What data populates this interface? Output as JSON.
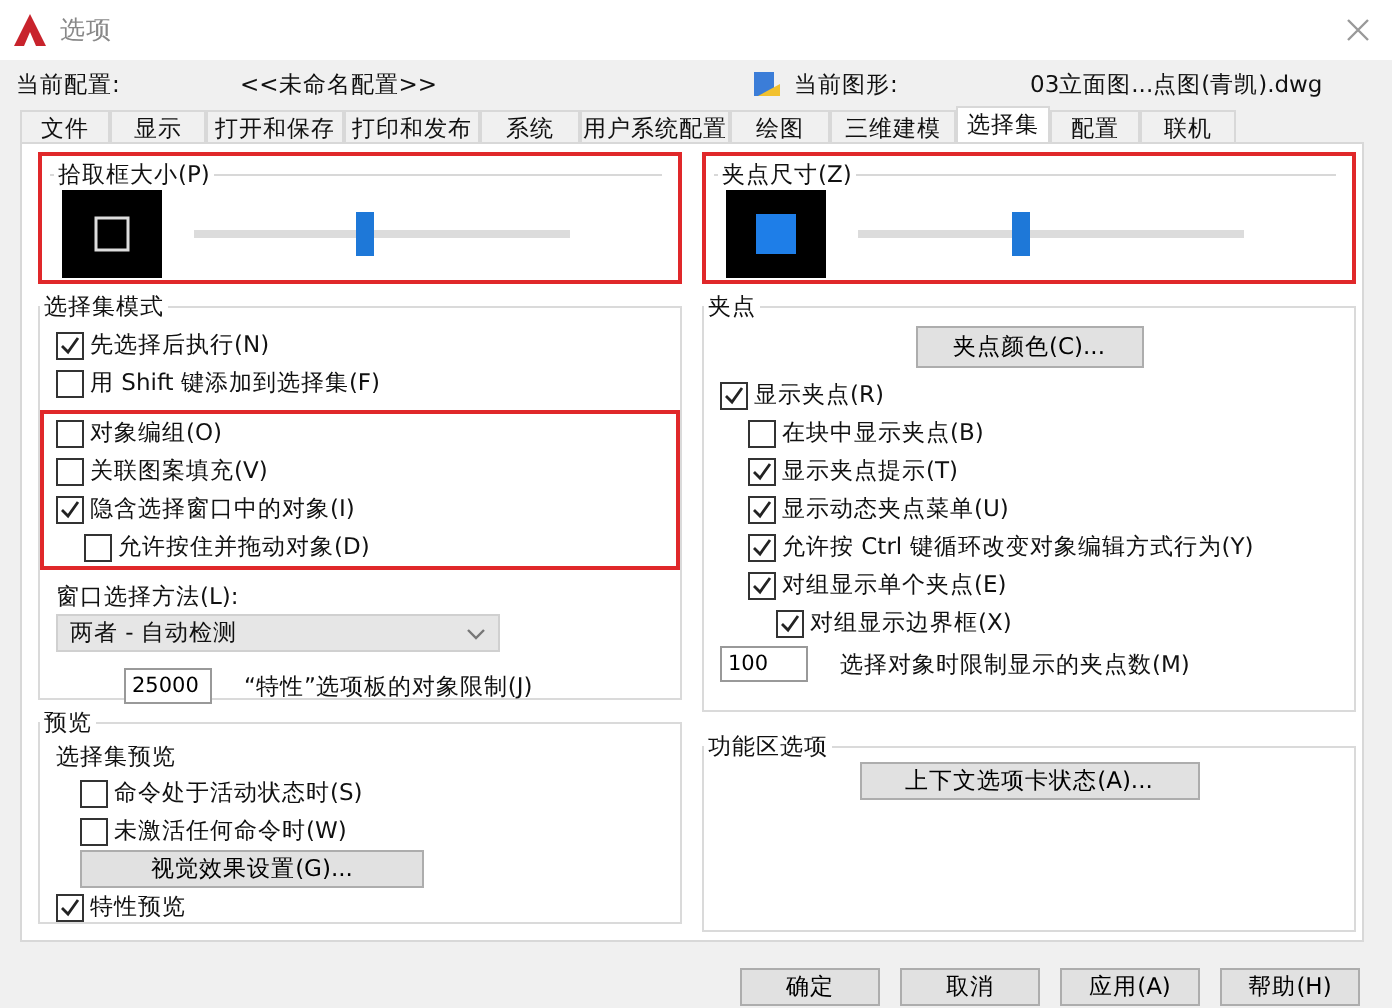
{
  "window": {
    "title": "选项"
  },
  "profile": {
    "label": "当前配置:",
    "value": "<<未命名配置>>"
  },
  "drawing": {
    "label": "当前图形:",
    "value": "03立面图...点图(青凯).dwg"
  },
  "tabs": [
    {
      "label": "文件",
      "selected": false
    },
    {
      "label": "显示",
      "selected": false
    },
    {
      "label": "打开和保存",
      "selected": false
    },
    {
      "label": "打印和发布",
      "selected": false
    },
    {
      "label": "系统",
      "selected": false
    },
    {
      "label": "用户系统配置",
      "selected": false
    },
    {
      "label": "绘图",
      "selected": false
    },
    {
      "label": "三维建模",
      "selected": false
    },
    {
      "label": "选择集",
      "selected": true
    },
    {
      "label": "配置",
      "selected": false
    },
    {
      "label": "联机",
      "selected": false
    }
  ],
  "pickbox": {
    "label": "拾取框大小(P)",
    "level": 0.45,
    "highlighted": true
  },
  "grip_size": {
    "label": "夹点尺寸(Z)",
    "level": 0.42,
    "highlighted": true
  },
  "selection_mode": {
    "title": "选择集模式",
    "groups": [
      {
        "items": [
          {
            "label": "先选择后执行(N)",
            "checked": true
          },
          {
            "label": "用 Shift 键添加到选择集(F)",
            "checked": false
          }
        ]
      },
      {
        "highlighted": true,
        "items": [
          {
            "label": "对象编组(O)",
            "checked": false
          },
          {
            "label": "关联图案填充(V)",
            "checked": false
          },
          {
            "label": "隐含选择窗口中的对象(I)",
            "checked": true,
            "children": [
              {
                "label": "允许按住并拖动对象(D)",
                "checked": false
              }
            ]
          }
        ]
      }
    ],
    "window_method": {
      "label": "窗口选择方法(L):",
      "value": "两者 - 自动检测"
    },
    "limit": {
      "value": "25000",
      "label": "“特性”选项板的对象限制(J)"
    }
  },
  "preview": {
    "title": "预览",
    "subtitle": "选择集预览",
    "items": [
      {
        "label": "命令处于活动状态时(S)",
        "checked": false
      },
      {
        "label": "未激活任何命令时(W)",
        "checked": false
      }
    ],
    "button": "视觉效果设置(G)...",
    "property_preview": {
      "label": "特性预览",
      "checked": true
    }
  },
  "grips": {
    "title": "夹点",
    "color_button": "夹点颜色(C)...",
    "items": [
      {
        "label": "显示夹点(R)",
        "checked": true,
        "children": [
          {
            "label": "在块中显示夹点(B)",
            "checked": false
          },
          {
            "label": "显示夹点提示(T)",
            "checked": true
          },
          {
            "label": "显示动态夹点菜单(U)",
            "checked": true
          },
          {
            "label": "允许按 Ctrl 键循环改变对象编辑方式行为(Y)",
            "checked": true
          },
          {
            "label": "对组显示单个夹点(E)",
            "checked": true,
            "children": [
              {
                "label": "对组显示边界框(X)",
                "checked": true
              }
            ]
          }
        ]
      }
    ],
    "limit": {
      "value": "100",
      "label": "选择对象时限制显示的夹点数(M)"
    }
  },
  "ribbon": {
    "title": "功能区选项",
    "button": "上下文选项卡状态(A)..."
  },
  "buttons": [
    "确定",
    "取消",
    "应用(A)",
    "帮助(H)"
  ]
}
